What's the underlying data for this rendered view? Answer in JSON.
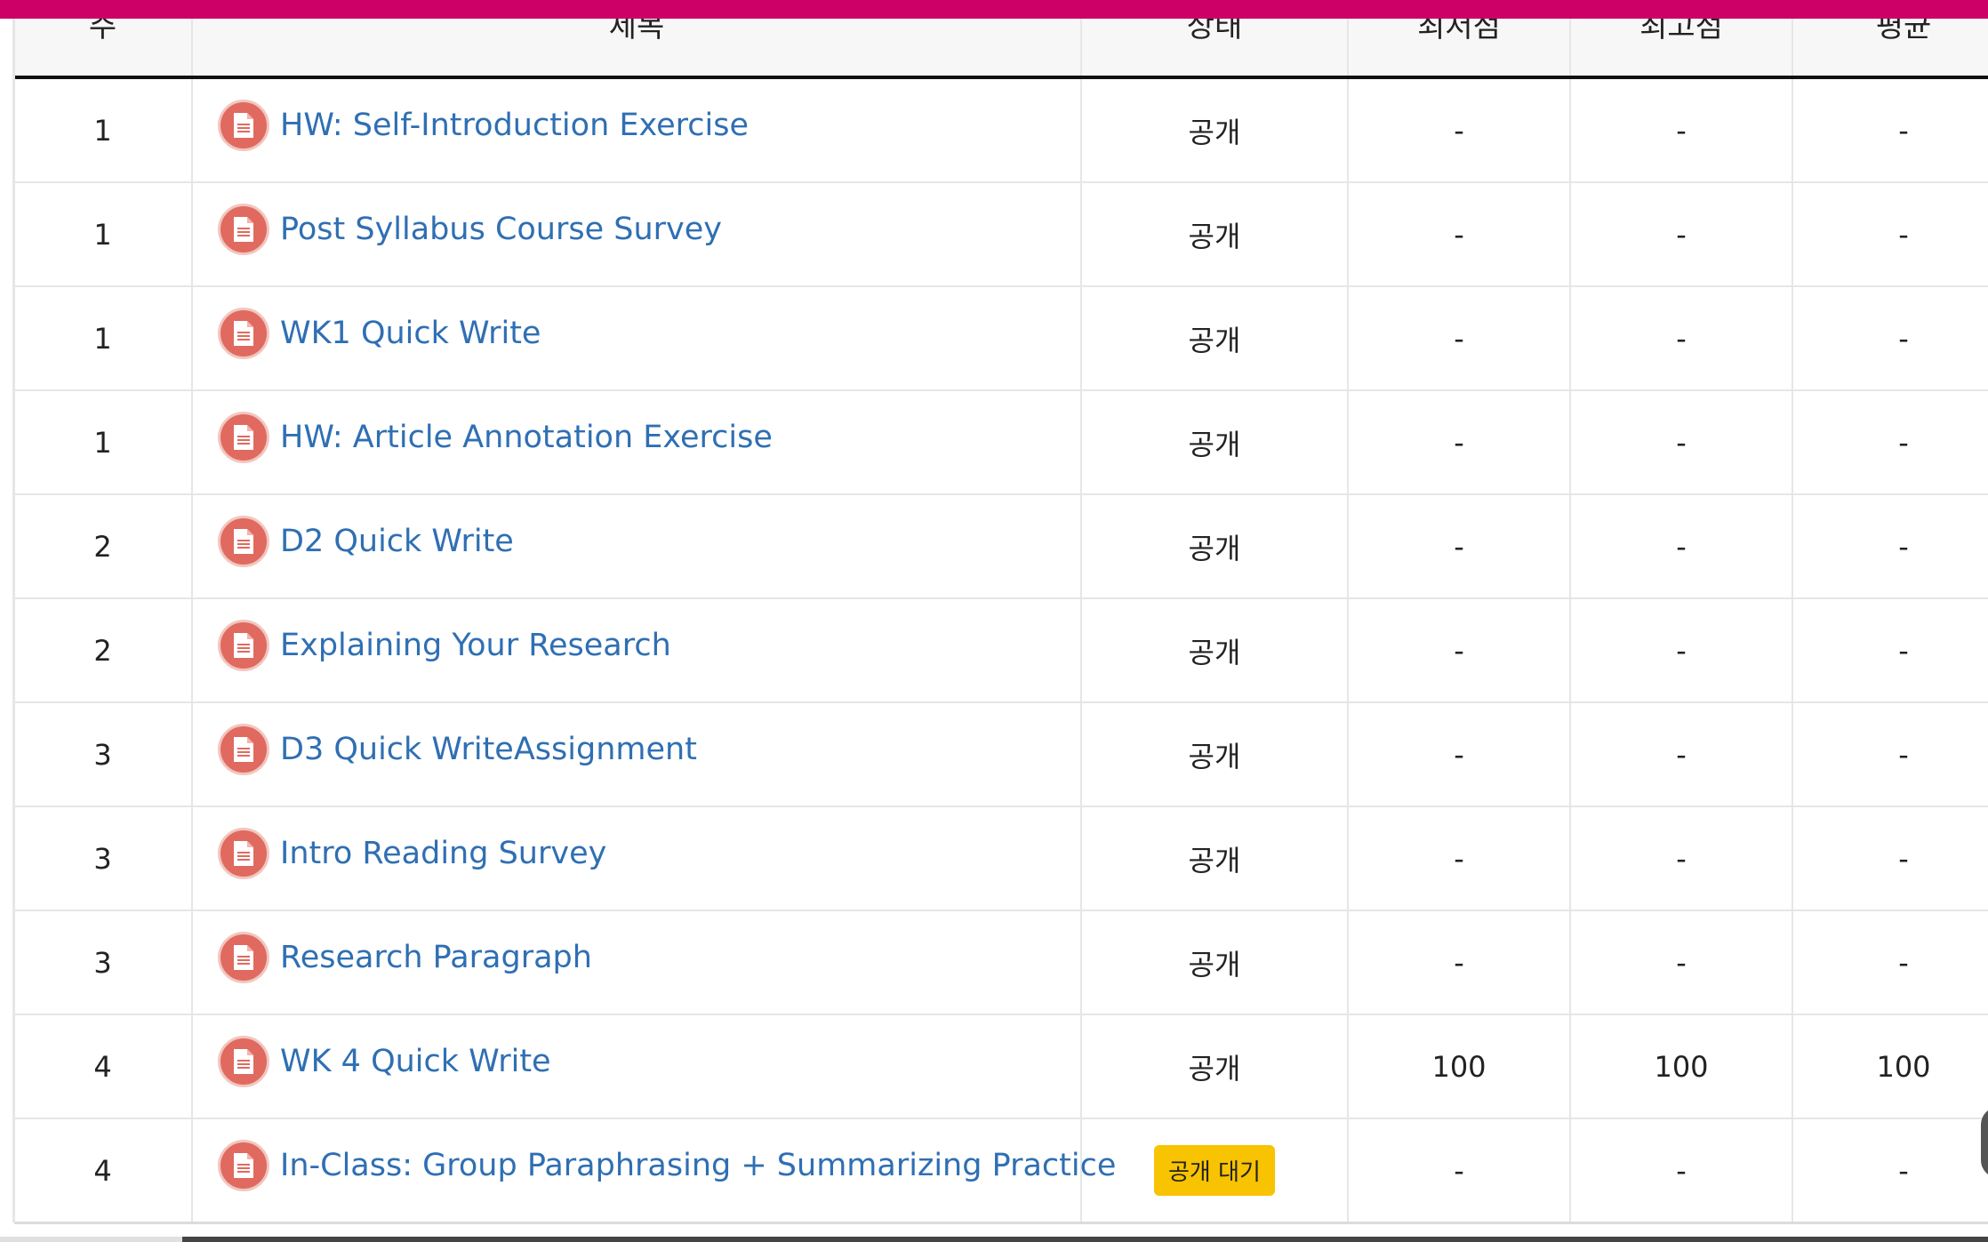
{
  "table": {
    "headers": {
      "week": "주",
      "title": "제목",
      "status": "상태",
      "min": "최저점",
      "max": "최고점",
      "avg": "평균"
    },
    "rows": [
      {
        "week": "1",
        "title": "HW: Self-Introduction Exercise",
        "status": "공개",
        "min": "-",
        "max": "-",
        "avg": "-"
      },
      {
        "week": "1",
        "title": "Post Syllabus Course Survey",
        "status": "공개",
        "min": "-",
        "max": "-",
        "avg": "-"
      },
      {
        "week": "1",
        "title": "WK1 Quick Write",
        "status": "공개",
        "min": "-",
        "max": "-",
        "avg": "-"
      },
      {
        "week": "1",
        "title": "HW: Article Annotation Exercise",
        "status": "공개",
        "min": "-",
        "max": "-",
        "avg": "-"
      },
      {
        "week": "2",
        "title": "D2 Quick Write",
        "status": "공개",
        "min": "-",
        "max": "-",
        "avg": "-"
      },
      {
        "week": "2",
        "title": "Explaining Your Research",
        "status": "공개",
        "min": "-",
        "max": "-",
        "avg": "-"
      },
      {
        "week": "3",
        "title": "D3 Quick WriteAssignment",
        "status": "공개",
        "min": "-",
        "max": "-",
        "avg": "-"
      },
      {
        "week": "3",
        "title": "Intro Reading Survey",
        "status": "공개",
        "min": "-",
        "max": "-",
        "avg": "-"
      },
      {
        "week": "3",
        "title": "Research Paragraph",
        "status": "공개",
        "min": "-",
        "max": "-",
        "avg": "-"
      },
      {
        "week": "4",
        "title": "WK 4 Quick Write",
        "status": "공개",
        "min": "100",
        "max": "100",
        "avg": "100"
      },
      {
        "week": "4",
        "title": "In-Class: Group Paraphrasing + Summarizing Practice",
        "status": "공개 대기",
        "status_badge": true,
        "min": "-",
        "max": "-",
        "avg": "-"
      }
    ]
  },
  "colors": {
    "accent_bar": "#cc0066",
    "link": "#2f6fb3",
    "icon": "#e06a5f",
    "badge": "#f8c300"
  },
  "icons": {
    "row_icon": "document-icon"
  }
}
